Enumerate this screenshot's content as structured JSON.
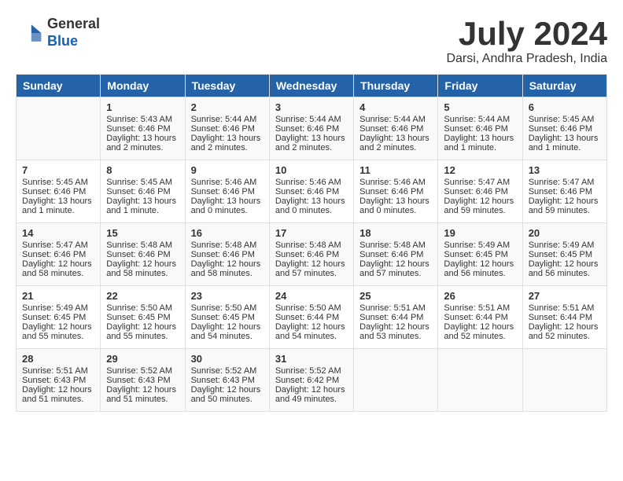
{
  "header": {
    "logo_line1": "General",
    "logo_line2": "Blue",
    "month_year": "July 2024",
    "location": "Darsi, Andhra Pradesh, India"
  },
  "days_of_week": [
    "Sunday",
    "Monday",
    "Tuesday",
    "Wednesday",
    "Thursday",
    "Friday",
    "Saturday"
  ],
  "weeks": [
    [
      {
        "day": "",
        "sunrise": "",
        "sunset": "",
        "daylight": ""
      },
      {
        "day": "1",
        "sunrise": "Sunrise: 5:43 AM",
        "sunset": "Sunset: 6:46 PM",
        "daylight": "Daylight: 13 hours and 2 minutes."
      },
      {
        "day": "2",
        "sunrise": "Sunrise: 5:44 AM",
        "sunset": "Sunset: 6:46 PM",
        "daylight": "Daylight: 13 hours and 2 minutes."
      },
      {
        "day": "3",
        "sunrise": "Sunrise: 5:44 AM",
        "sunset": "Sunset: 6:46 PM",
        "daylight": "Daylight: 13 hours and 2 minutes."
      },
      {
        "day": "4",
        "sunrise": "Sunrise: 5:44 AM",
        "sunset": "Sunset: 6:46 PM",
        "daylight": "Daylight: 13 hours and 2 minutes."
      },
      {
        "day": "5",
        "sunrise": "Sunrise: 5:44 AM",
        "sunset": "Sunset: 6:46 PM",
        "daylight": "Daylight: 13 hours and 1 minute."
      },
      {
        "day": "6",
        "sunrise": "Sunrise: 5:45 AM",
        "sunset": "Sunset: 6:46 PM",
        "daylight": "Daylight: 13 hours and 1 minute."
      }
    ],
    [
      {
        "day": "7",
        "sunrise": "Sunrise: 5:45 AM",
        "sunset": "Sunset: 6:46 PM",
        "daylight": "Daylight: 13 hours and 1 minute."
      },
      {
        "day": "8",
        "sunrise": "Sunrise: 5:45 AM",
        "sunset": "Sunset: 6:46 PM",
        "daylight": "Daylight: 13 hours and 1 minute."
      },
      {
        "day": "9",
        "sunrise": "Sunrise: 5:46 AM",
        "sunset": "Sunset: 6:46 PM",
        "daylight": "Daylight: 13 hours and 0 minutes."
      },
      {
        "day": "10",
        "sunrise": "Sunrise: 5:46 AM",
        "sunset": "Sunset: 6:46 PM",
        "daylight": "Daylight: 13 hours and 0 minutes."
      },
      {
        "day": "11",
        "sunrise": "Sunrise: 5:46 AM",
        "sunset": "Sunset: 6:46 PM",
        "daylight": "Daylight: 13 hours and 0 minutes."
      },
      {
        "day": "12",
        "sunrise": "Sunrise: 5:47 AM",
        "sunset": "Sunset: 6:46 PM",
        "daylight": "Daylight: 12 hours and 59 minutes."
      },
      {
        "day": "13",
        "sunrise": "Sunrise: 5:47 AM",
        "sunset": "Sunset: 6:46 PM",
        "daylight": "Daylight: 12 hours and 59 minutes."
      }
    ],
    [
      {
        "day": "14",
        "sunrise": "Sunrise: 5:47 AM",
        "sunset": "Sunset: 6:46 PM",
        "daylight": "Daylight: 12 hours and 58 minutes."
      },
      {
        "day": "15",
        "sunrise": "Sunrise: 5:48 AM",
        "sunset": "Sunset: 6:46 PM",
        "daylight": "Daylight: 12 hours and 58 minutes."
      },
      {
        "day": "16",
        "sunrise": "Sunrise: 5:48 AM",
        "sunset": "Sunset: 6:46 PM",
        "daylight": "Daylight: 12 hours and 58 minutes."
      },
      {
        "day": "17",
        "sunrise": "Sunrise: 5:48 AM",
        "sunset": "Sunset: 6:46 PM",
        "daylight": "Daylight: 12 hours and 57 minutes."
      },
      {
        "day": "18",
        "sunrise": "Sunrise: 5:48 AM",
        "sunset": "Sunset: 6:46 PM",
        "daylight": "Daylight: 12 hours and 57 minutes."
      },
      {
        "day": "19",
        "sunrise": "Sunrise: 5:49 AM",
        "sunset": "Sunset: 6:45 PM",
        "daylight": "Daylight: 12 hours and 56 minutes."
      },
      {
        "day": "20",
        "sunrise": "Sunrise: 5:49 AM",
        "sunset": "Sunset: 6:45 PM",
        "daylight": "Daylight: 12 hours and 56 minutes."
      }
    ],
    [
      {
        "day": "21",
        "sunrise": "Sunrise: 5:49 AM",
        "sunset": "Sunset: 6:45 PM",
        "daylight": "Daylight: 12 hours and 55 minutes."
      },
      {
        "day": "22",
        "sunrise": "Sunrise: 5:50 AM",
        "sunset": "Sunset: 6:45 PM",
        "daylight": "Daylight: 12 hours and 55 minutes."
      },
      {
        "day": "23",
        "sunrise": "Sunrise: 5:50 AM",
        "sunset": "Sunset: 6:45 PM",
        "daylight": "Daylight: 12 hours and 54 minutes."
      },
      {
        "day": "24",
        "sunrise": "Sunrise: 5:50 AM",
        "sunset": "Sunset: 6:44 PM",
        "daylight": "Daylight: 12 hours and 54 minutes."
      },
      {
        "day": "25",
        "sunrise": "Sunrise: 5:51 AM",
        "sunset": "Sunset: 6:44 PM",
        "daylight": "Daylight: 12 hours and 53 minutes."
      },
      {
        "day": "26",
        "sunrise": "Sunrise: 5:51 AM",
        "sunset": "Sunset: 6:44 PM",
        "daylight": "Daylight: 12 hours and 52 minutes."
      },
      {
        "day": "27",
        "sunrise": "Sunrise: 5:51 AM",
        "sunset": "Sunset: 6:44 PM",
        "daylight": "Daylight: 12 hours and 52 minutes."
      }
    ],
    [
      {
        "day": "28",
        "sunrise": "Sunrise: 5:51 AM",
        "sunset": "Sunset: 6:43 PM",
        "daylight": "Daylight: 12 hours and 51 minutes."
      },
      {
        "day": "29",
        "sunrise": "Sunrise: 5:52 AM",
        "sunset": "Sunset: 6:43 PM",
        "daylight": "Daylight: 12 hours and 51 minutes."
      },
      {
        "day": "30",
        "sunrise": "Sunrise: 5:52 AM",
        "sunset": "Sunset: 6:43 PM",
        "daylight": "Daylight: 12 hours and 50 minutes."
      },
      {
        "day": "31",
        "sunrise": "Sunrise: 5:52 AM",
        "sunset": "Sunset: 6:42 PM",
        "daylight": "Daylight: 12 hours and 49 minutes."
      },
      {
        "day": "",
        "sunrise": "",
        "sunset": "",
        "daylight": ""
      },
      {
        "day": "",
        "sunrise": "",
        "sunset": "",
        "daylight": ""
      },
      {
        "day": "",
        "sunrise": "",
        "sunset": "",
        "daylight": ""
      }
    ]
  ]
}
